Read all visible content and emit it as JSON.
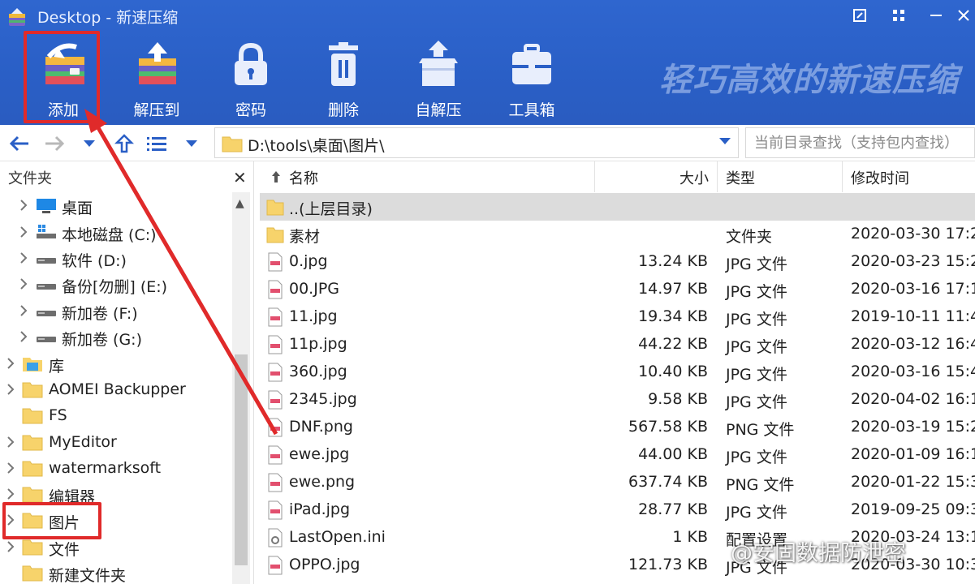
{
  "window": {
    "title": "Desktop - 新速压缩",
    "slogan": "轻巧高效的新速压缩"
  },
  "toolbar": {
    "buttons": [
      {
        "label": "添加",
        "icon": "add-archive-icon"
      },
      {
        "label": "解压到",
        "icon": "extract-icon"
      },
      {
        "label": "密码",
        "icon": "lock-icon"
      },
      {
        "label": "删除",
        "icon": "trash-icon"
      },
      {
        "label": "自解压",
        "icon": "self-extract-icon"
      },
      {
        "label": "工具箱",
        "icon": "toolbox-icon"
      }
    ]
  },
  "address": {
    "path": "D:\\tools\\桌面\\图片\\",
    "search_placeholder": "当前目录查找（支持包内查找）"
  },
  "sidebar": {
    "title": "文件夹",
    "items": [
      {
        "label": "桌面",
        "icon": "desktop-icon"
      },
      {
        "label": "本地磁盘 (C:)",
        "icon": "system-drive-icon"
      },
      {
        "label": "软件 (D:)",
        "icon": "drive-icon"
      },
      {
        "label": "备份[勿删] (E:)",
        "icon": "drive-icon"
      },
      {
        "label": "新加卷 (F:)",
        "icon": "drive-icon"
      },
      {
        "label": "新加卷 (G:)",
        "icon": "drive-icon"
      },
      {
        "label": "库",
        "icon": "library-icon"
      },
      {
        "label": "AOMEI Backupper",
        "icon": "folder-icon"
      },
      {
        "label": "FS",
        "icon": "folder-icon"
      },
      {
        "label": "MyEditor",
        "icon": "folder-icon"
      },
      {
        "label": "watermarksoft",
        "icon": "folder-icon"
      },
      {
        "label": "编辑器",
        "icon": "folder-icon"
      },
      {
        "label": "图片",
        "icon": "folder-icon"
      },
      {
        "label": "文件",
        "icon": "folder-icon"
      },
      {
        "label": "新建文件夹",
        "icon": "folder-icon"
      }
    ]
  },
  "filelist": {
    "columns": [
      "名称",
      "大小",
      "类型",
      "修改时间"
    ],
    "rows": [
      {
        "name": "..(上层目录)",
        "size": "",
        "type": "",
        "date": "",
        "icon": "folder-icon"
      },
      {
        "name": "素材",
        "size": "",
        "type": "文件夹",
        "date": "2020-03-30 17:2",
        "icon": "folder-icon"
      },
      {
        "name": "0.jpg",
        "size": "13.24 KB",
        "type": "JPG 文件",
        "date": "2020-03-23 15:2",
        "icon": "image-file-icon"
      },
      {
        "name": "00.JPG",
        "size": "14.97 KB",
        "type": "JPG 文件",
        "date": "2020-03-16 17:1",
        "icon": "image-file-icon"
      },
      {
        "name": "11.jpg",
        "size": "19.34 KB",
        "type": "JPG 文件",
        "date": "2019-10-11 11:4",
        "icon": "image-file-icon"
      },
      {
        "name": "11p.jpg",
        "size": "44.22 KB",
        "type": "JPG 文件",
        "date": "2020-03-12 16:4",
        "icon": "image-file-icon"
      },
      {
        "name": "360.jpg",
        "size": "10.40 KB",
        "type": "JPG 文件",
        "date": "2020-03-16 15:4",
        "icon": "image-file-icon"
      },
      {
        "name": "2345.jpg",
        "size": "9.58 KB",
        "type": "JPG 文件",
        "date": "2020-04-02 16:1",
        "icon": "image-file-icon"
      },
      {
        "name": "DNF.png",
        "size": "567.58 KB",
        "type": "PNG 文件",
        "date": "2020-03-19 15:2",
        "icon": "image-file-icon"
      },
      {
        "name": "ewe.jpg",
        "size": "44.00 KB",
        "type": "JPG 文件",
        "date": "2020-01-09 16:1",
        "icon": "image-file-icon"
      },
      {
        "name": "ewe.png",
        "size": "637.74 KB",
        "type": "PNG 文件",
        "date": "2020-01-22 15:3",
        "icon": "image-file-icon"
      },
      {
        "name": "iPad.jpg",
        "size": "28.77 KB",
        "type": "JPG 文件",
        "date": "2019-09-25 09:3",
        "icon": "image-file-icon"
      },
      {
        "name": "LastOpen.ini",
        "size": "1 KB",
        "type": "配置设置",
        "date": "2020-03-24 13:1",
        "icon": "settings-file-icon"
      },
      {
        "name": "OPPO.jpg",
        "size": "121.73 KB",
        "type": "JPG 文件",
        "date": "2020-03-30 10:3",
        "icon": "image-file-icon"
      }
    ]
  },
  "watermark": "@安固数据防泄密",
  "colors": {
    "header_bg": "#2a5fc6",
    "highlight_red": "#e02a2a",
    "selected_row": "#dcdcdc",
    "folder_yellow": "#f7d36b"
  }
}
